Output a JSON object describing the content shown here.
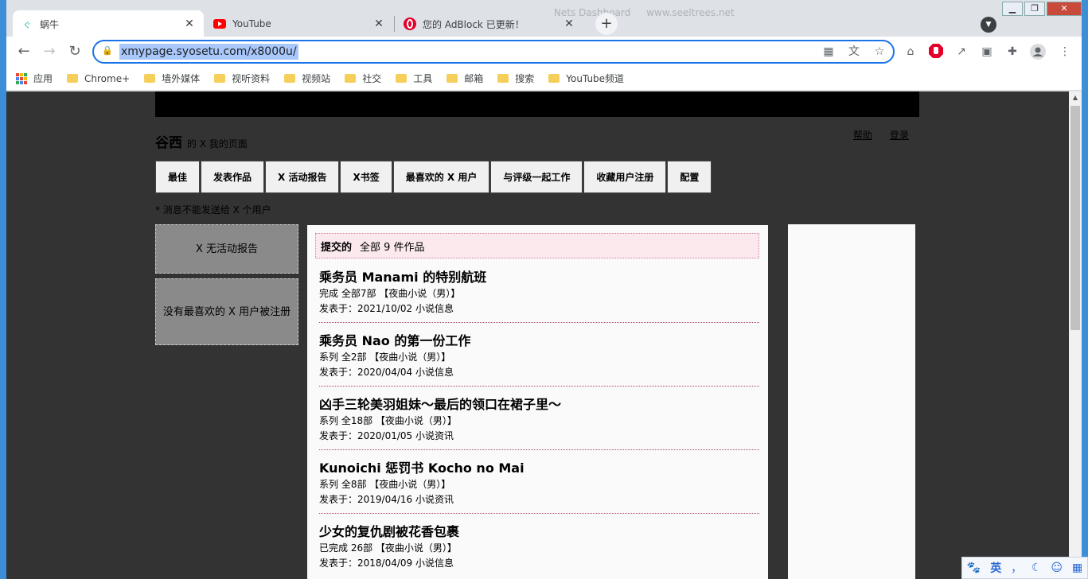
{
  "browser": {
    "tabs": [
      {
        "title": "蜗牛",
        "favicon": "snail-icon",
        "active": true
      },
      {
        "title": "YouTube",
        "favicon": "youtube-icon",
        "active": false
      },
      {
        "title": "您的 AdBlock 已更新！",
        "favicon": "adblock-icon",
        "active": false
      }
    ],
    "background_tabs": [
      "Nets Dashboard",
      "www.seeltrees.net"
    ],
    "url": "xmypage.syosetu.com/x8000u/",
    "bookmarks": [
      {
        "label": "应用",
        "type": "apps"
      },
      {
        "label": "Chrome+",
        "type": "folder"
      },
      {
        "label": "墙外媒体",
        "type": "folder"
      },
      {
        "label": "视听资料",
        "type": "folder"
      },
      {
        "label": "视频站",
        "type": "folder"
      },
      {
        "label": "社交",
        "type": "folder"
      },
      {
        "label": "工具",
        "type": "folder"
      },
      {
        "label": "邮箱",
        "type": "folder"
      },
      {
        "label": "搜索",
        "type": "folder"
      },
      {
        "label": "YouTube频道",
        "type": "folder"
      }
    ]
  },
  "page": {
    "user_name": "谷西",
    "user_sub": "的 X 我的页面",
    "help": "帮助",
    "login": "登录",
    "menu": [
      "最佳",
      "发表作品",
      "X 活动报告",
      "X书签",
      "最喜欢的 X 用户",
      "与评级一起工作",
      "收藏用户注册",
      "配置"
    ],
    "notice": "* 消息不能发送给 X 个用户",
    "side": {
      "no_activity": "X 无活动报告",
      "no_favorite": "没有最喜欢的 X 用户被注册"
    },
    "submitted": {
      "label": "提交的",
      "count_text": "全部 9 件作品"
    },
    "works": [
      {
        "title": "乘务员 Manami 的特别航班",
        "meta": "完成 全部7部 【夜曲小说（男）】",
        "date": "发表于：2021/10/02  小说信息"
      },
      {
        "title": "乘务员 Nao 的第一份工作",
        "meta": "系列 全2部 【夜曲小说（男）】",
        "date": "发表于：2020/04/04  小说信息"
      },
      {
        "title": "凶手三轮美羽姐妹～最后的领口在裙子里～",
        "meta": "系列 全18部 【夜曲小说（男）】",
        "date": "发表于：2020/01/05  小说资讯"
      },
      {
        "title": "Kunoichi 惩罚书 Kocho no Mai",
        "meta": "系列 全8部 【夜曲小说（男）】",
        "date": "发表于：2019/04/16  小说资讯"
      },
      {
        "title": "少女的复仇剧被花香包裹",
        "meta": "已完成 26部 【夜曲小说（男）】",
        "date": "发表于：2018/04/09  小说信息"
      }
    ]
  },
  "ime": {
    "lang": "英",
    "punct": "，",
    "moon": "☾"
  },
  "colors": {
    "accent": "#1a73e8",
    "page_bg": "#333333",
    "submitted_bg": "#fbe9ee"
  }
}
